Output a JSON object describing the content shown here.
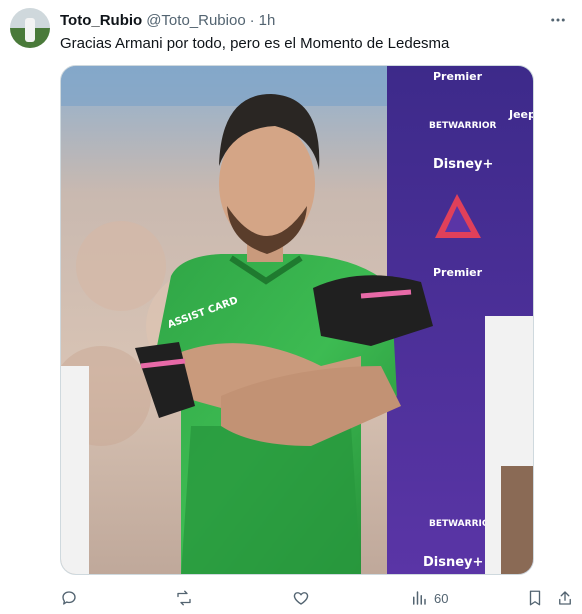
{
  "tweet": {
    "display_name": "Toto_Rubio",
    "handle": "@Toto_Rubioo",
    "separator": "·",
    "time": "1h",
    "text": "Gracias Armani por todo, pero es el Momento de Ledesma"
  },
  "media": {
    "icon": "photo-image",
    "background_words": [
      "Premier",
      "BETWARRIOR",
      "Jeep",
      "Disney+",
      "Premier",
      "BETWARRIOR",
      "Disney+"
    ],
    "jersey_text": "ASSIST CARD"
  },
  "actions": {
    "reply_icon": "reply-icon",
    "repost_icon": "repost-icon",
    "like_icon": "heart-icon",
    "views_icon": "views-icon",
    "views_count": "60",
    "bookmark_icon": "bookmark-icon",
    "share_icon": "share-icon"
  },
  "colors": {
    "text_primary": "#0f1419",
    "text_secondary": "#536471",
    "jersey_green": "#2e9a3e",
    "banner_purple": "#4b2b8f"
  }
}
